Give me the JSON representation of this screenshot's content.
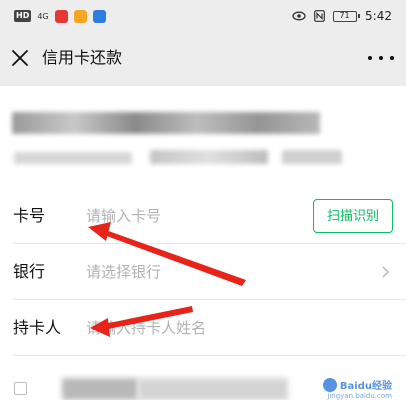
{
  "status_bar": {
    "hd_label": "HD",
    "network_label": "4G",
    "app_icon_colors": [
      "#e53935",
      "#f5a623",
      "#2f7de1"
    ],
    "battery_label": "71",
    "time": "5:42"
  },
  "nav": {
    "title": "信用卡还款",
    "close_icon": "close-icon",
    "more_icon": "more-icon"
  },
  "form": {
    "card_number": {
      "label": "卡号",
      "placeholder": "请输入卡号",
      "action_label": "扫描识别"
    },
    "bank": {
      "label": "银行",
      "placeholder": "请选择银行"
    },
    "cardholder": {
      "label": "持卡人",
      "placeholder": "请输入持卡人姓名"
    }
  },
  "watermark": {
    "text": "Baidu经验",
    "url": "jingyan.baidu.com"
  },
  "colors": {
    "accent": "#07c160",
    "annotation": "#e8231a",
    "background": "#ededed"
  }
}
